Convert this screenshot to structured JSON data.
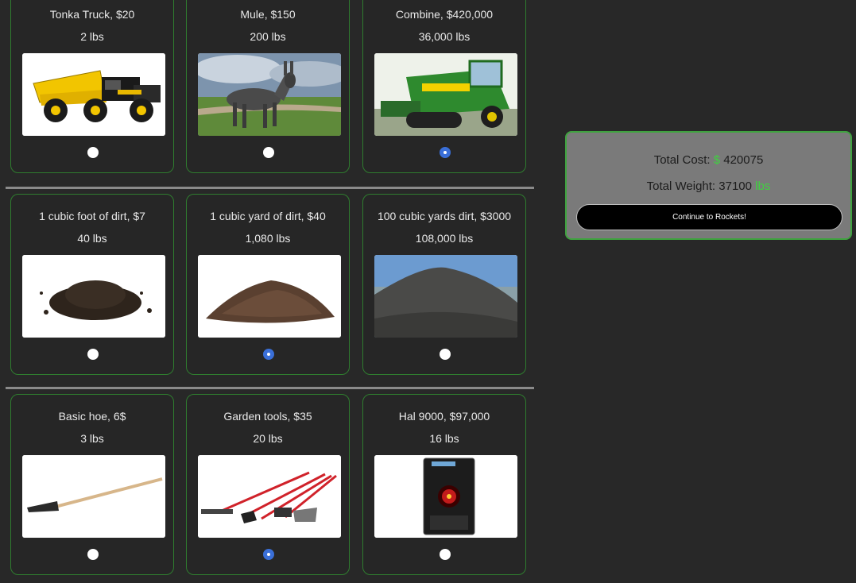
{
  "rows": [
    [
      {
        "name": "Tonka Truck, $20",
        "weight": "2 lbs",
        "icon": "toy-truck-image",
        "selected": false
      },
      {
        "name": "Mule, $150",
        "weight": "200 lbs",
        "icon": "mule-image",
        "selected": false
      },
      {
        "name": "Combine, $420,000",
        "weight": "36,000 lbs",
        "icon": "combine-harvester-image",
        "selected": true
      }
    ],
    [
      {
        "name": "1 cubic foot of dirt, $7",
        "weight": "40 lbs",
        "icon": "dirt-pile-image",
        "selected": false
      },
      {
        "name": "1 cubic yard of dirt, $40",
        "weight": "1,080 lbs",
        "icon": "dirt-mound-image",
        "selected": true
      },
      {
        "name": "100 cubic yards dirt, $3000",
        "weight": "108,000 lbs",
        "icon": "dirt-hill-image",
        "selected": false
      }
    ],
    [
      {
        "name": "Basic hoe, 6$",
        "weight": "3 lbs",
        "icon": "hoe-image",
        "selected": false
      },
      {
        "name": "Garden tools, $35",
        "weight": "20 lbs",
        "icon": "garden-tools-image",
        "selected": true
      },
      {
        "name": "Hal 9000, $97,000",
        "weight": "16 lbs",
        "icon": "hal-9000-image",
        "selected": false
      }
    ]
  ],
  "summary": {
    "cost_label": "Total Cost:",
    "currency": "$",
    "cost_value": "420075",
    "weight_label": "Total Weight:",
    "weight_value": "37100",
    "weight_unit": "lbs",
    "button_label": "Continue to Rockets!"
  },
  "colors": {
    "background": "#282828",
    "card_border": "#2f7d2f",
    "accent_green": "#3fd23f",
    "radio_selected": "#3a6fd8",
    "summary_bg": "#7a7a7a"
  }
}
